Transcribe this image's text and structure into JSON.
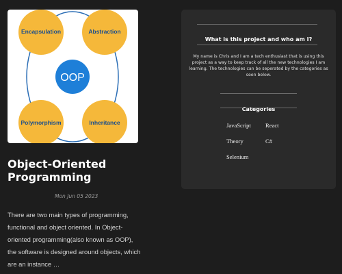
{
  "post": {
    "image": {
      "center_label": "OOP",
      "quadrants": [
        "Encapsulation",
        "Abstraction",
        "Polymorphism",
        "Inheritance"
      ]
    },
    "title": "Object-Oriented Programming",
    "date": "Mon Jun 05 2023",
    "excerpt": "There are two main types of programming, functional and object oriented. In Object-oriented programming(also known as OOP), the software is designed around objects, which are an instance …"
  },
  "about": {
    "heading": "What is this project and who am I?",
    "body": "My name is Chris and I am a tech enthusiast that is using this project as a way to keep track of all the new technologies I am learning. The technologies can be seperated by the categories as seen below."
  },
  "categories": {
    "heading": "Categories",
    "items": [
      "JavaScript",
      "React",
      "Theory",
      "C#",
      "Selenium"
    ]
  },
  "colors": {
    "background": "#1d1d1d",
    "card": "#2a2a2a",
    "oop_circle": "#1e7fd8",
    "quadrant_circle": "#f5b83a",
    "ring": "#2a6db5"
  }
}
